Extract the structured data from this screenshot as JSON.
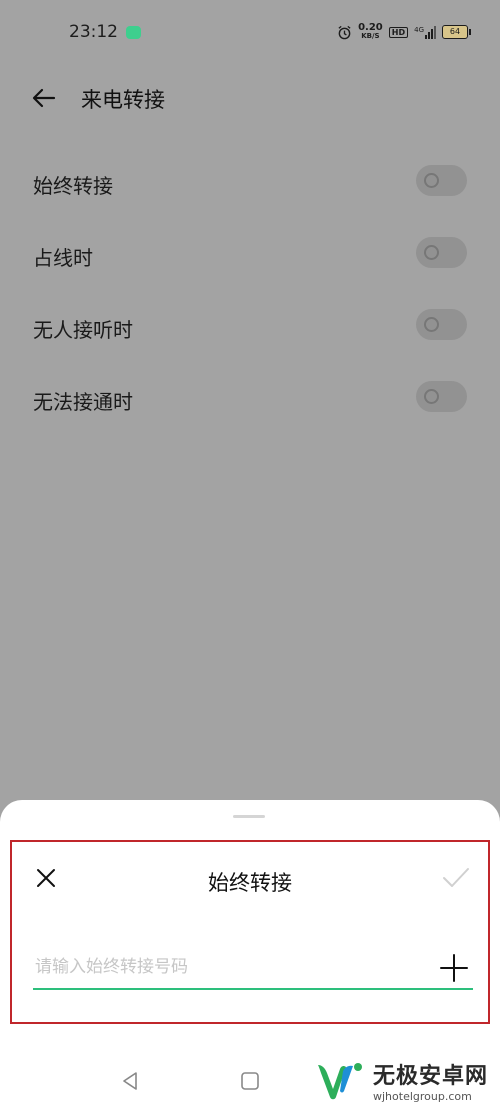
{
  "status_bar": {
    "time": "23:12",
    "net_speed_value": "0.20",
    "net_speed_unit": "KB/S",
    "hd": "HD",
    "signal": "4G",
    "battery": "64"
  },
  "header": {
    "title": "来电转接"
  },
  "settings": [
    {
      "label": "始终转接",
      "enabled": false
    },
    {
      "label": "占线时",
      "enabled": false
    },
    {
      "label": "无人接听时",
      "enabled": false
    },
    {
      "label": "无法接通时",
      "enabled": false
    }
  ],
  "dialog": {
    "title": "始终转接",
    "input_placeholder": "请输入始终转接号码",
    "input_value": ""
  },
  "watermark": {
    "name": "无极安卓网",
    "url": "wjhotelgroup.com"
  },
  "colors": {
    "accent": "#2dbf7c",
    "highlight_border": "#c0262b",
    "overlay": "#a3a3a3"
  }
}
